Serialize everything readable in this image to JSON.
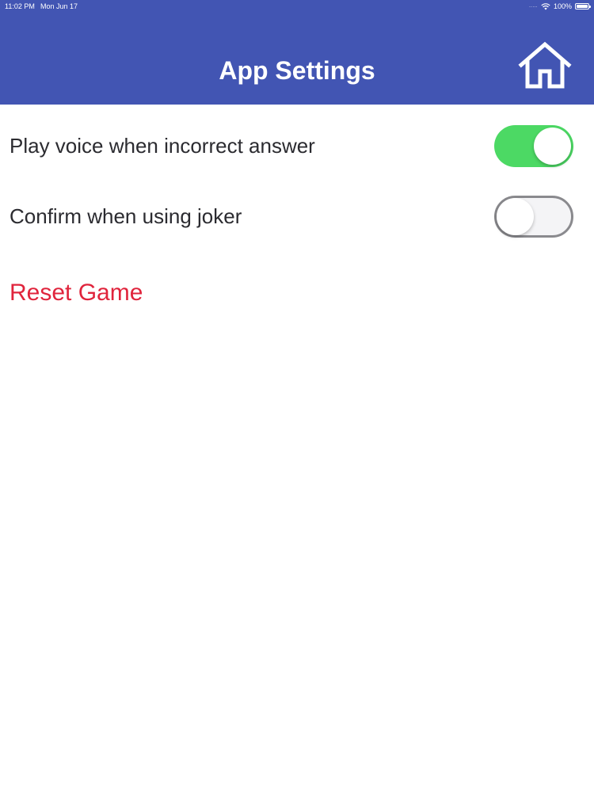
{
  "status_bar": {
    "time": "11:02 PM",
    "date": "Mon Jun 17",
    "signal": ".....",
    "battery": "100%"
  },
  "header": {
    "title": "App Settings",
    "background_color": "#4255b3",
    "home_icon": "home-icon"
  },
  "settings": {
    "voice": {
      "label": "Play voice when incorrect answer",
      "enabled": true,
      "on_color": "#4cd964"
    },
    "joker": {
      "label": "Confirm when using joker",
      "enabled": false
    }
  },
  "reset": {
    "label": "Reset Game",
    "color": "#e0243c"
  }
}
